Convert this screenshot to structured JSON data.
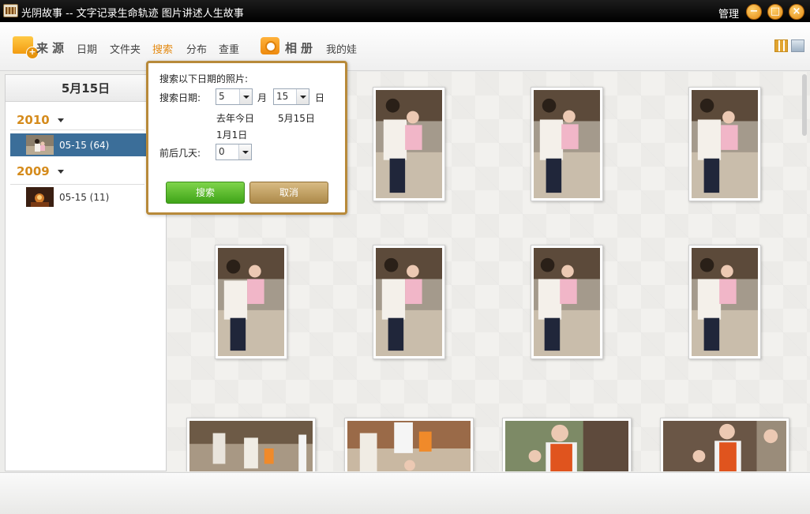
{
  "window": {
    "title": "光阴故事 -- 文字记录生命轨迹 图片讲述人生故事",
    "manage_label": "管理",
    "min_glyph": "−",
    "max_glyph": "□",
    "close_glyph": "×"
  },
  "toolbar": {
    "source_label": "来源",
    "source_items": [
      "日期",
      "文件夹",
      "搜索",
      "分布",
      "查重"
    ],
    "active_item": "搜索",
    "album_label": "相册",
    "album_items": [
      "我的娃"
    ]
  },
  "sidebar": {
    "date_header": "5月15日",
    "groups": [
      {
        "year": "2010",
        "rows": [
          {
            "label": "05-15 (64)",
            "selected": true
          }
        ]
      },
      {
        "year": "2009",
        "rows": [
          {
            "label": "05-15 (11)",
            "selected": false
          }
        ]
      }
    ]
  },
  "search_popup": {
    "heading": "搜索以下日期的照片:",
    "date_label": "搜索日期:",
    "month_value": "5",
    "month_unit": "月",
    "day_value": "15",
    "day_unit": "日",
    "quick_last_year": "去年今日",
    "quick_date": "5月15日",
    "quick_new_year": "1月1日",
    "range_label": "前后几天:",
    "range_value": "0",
    "search_button": "搜索",
    "cancel_button": "取消"
  },
  "colors": {
    "accent_orange": "#e48a12",
    "selected_row": "#3b6e99",
    "search_green": "#4cb31f",
    "cancel_tan": "#b08e4e",
    "popup_border": "#b88a3a"
  }
}
